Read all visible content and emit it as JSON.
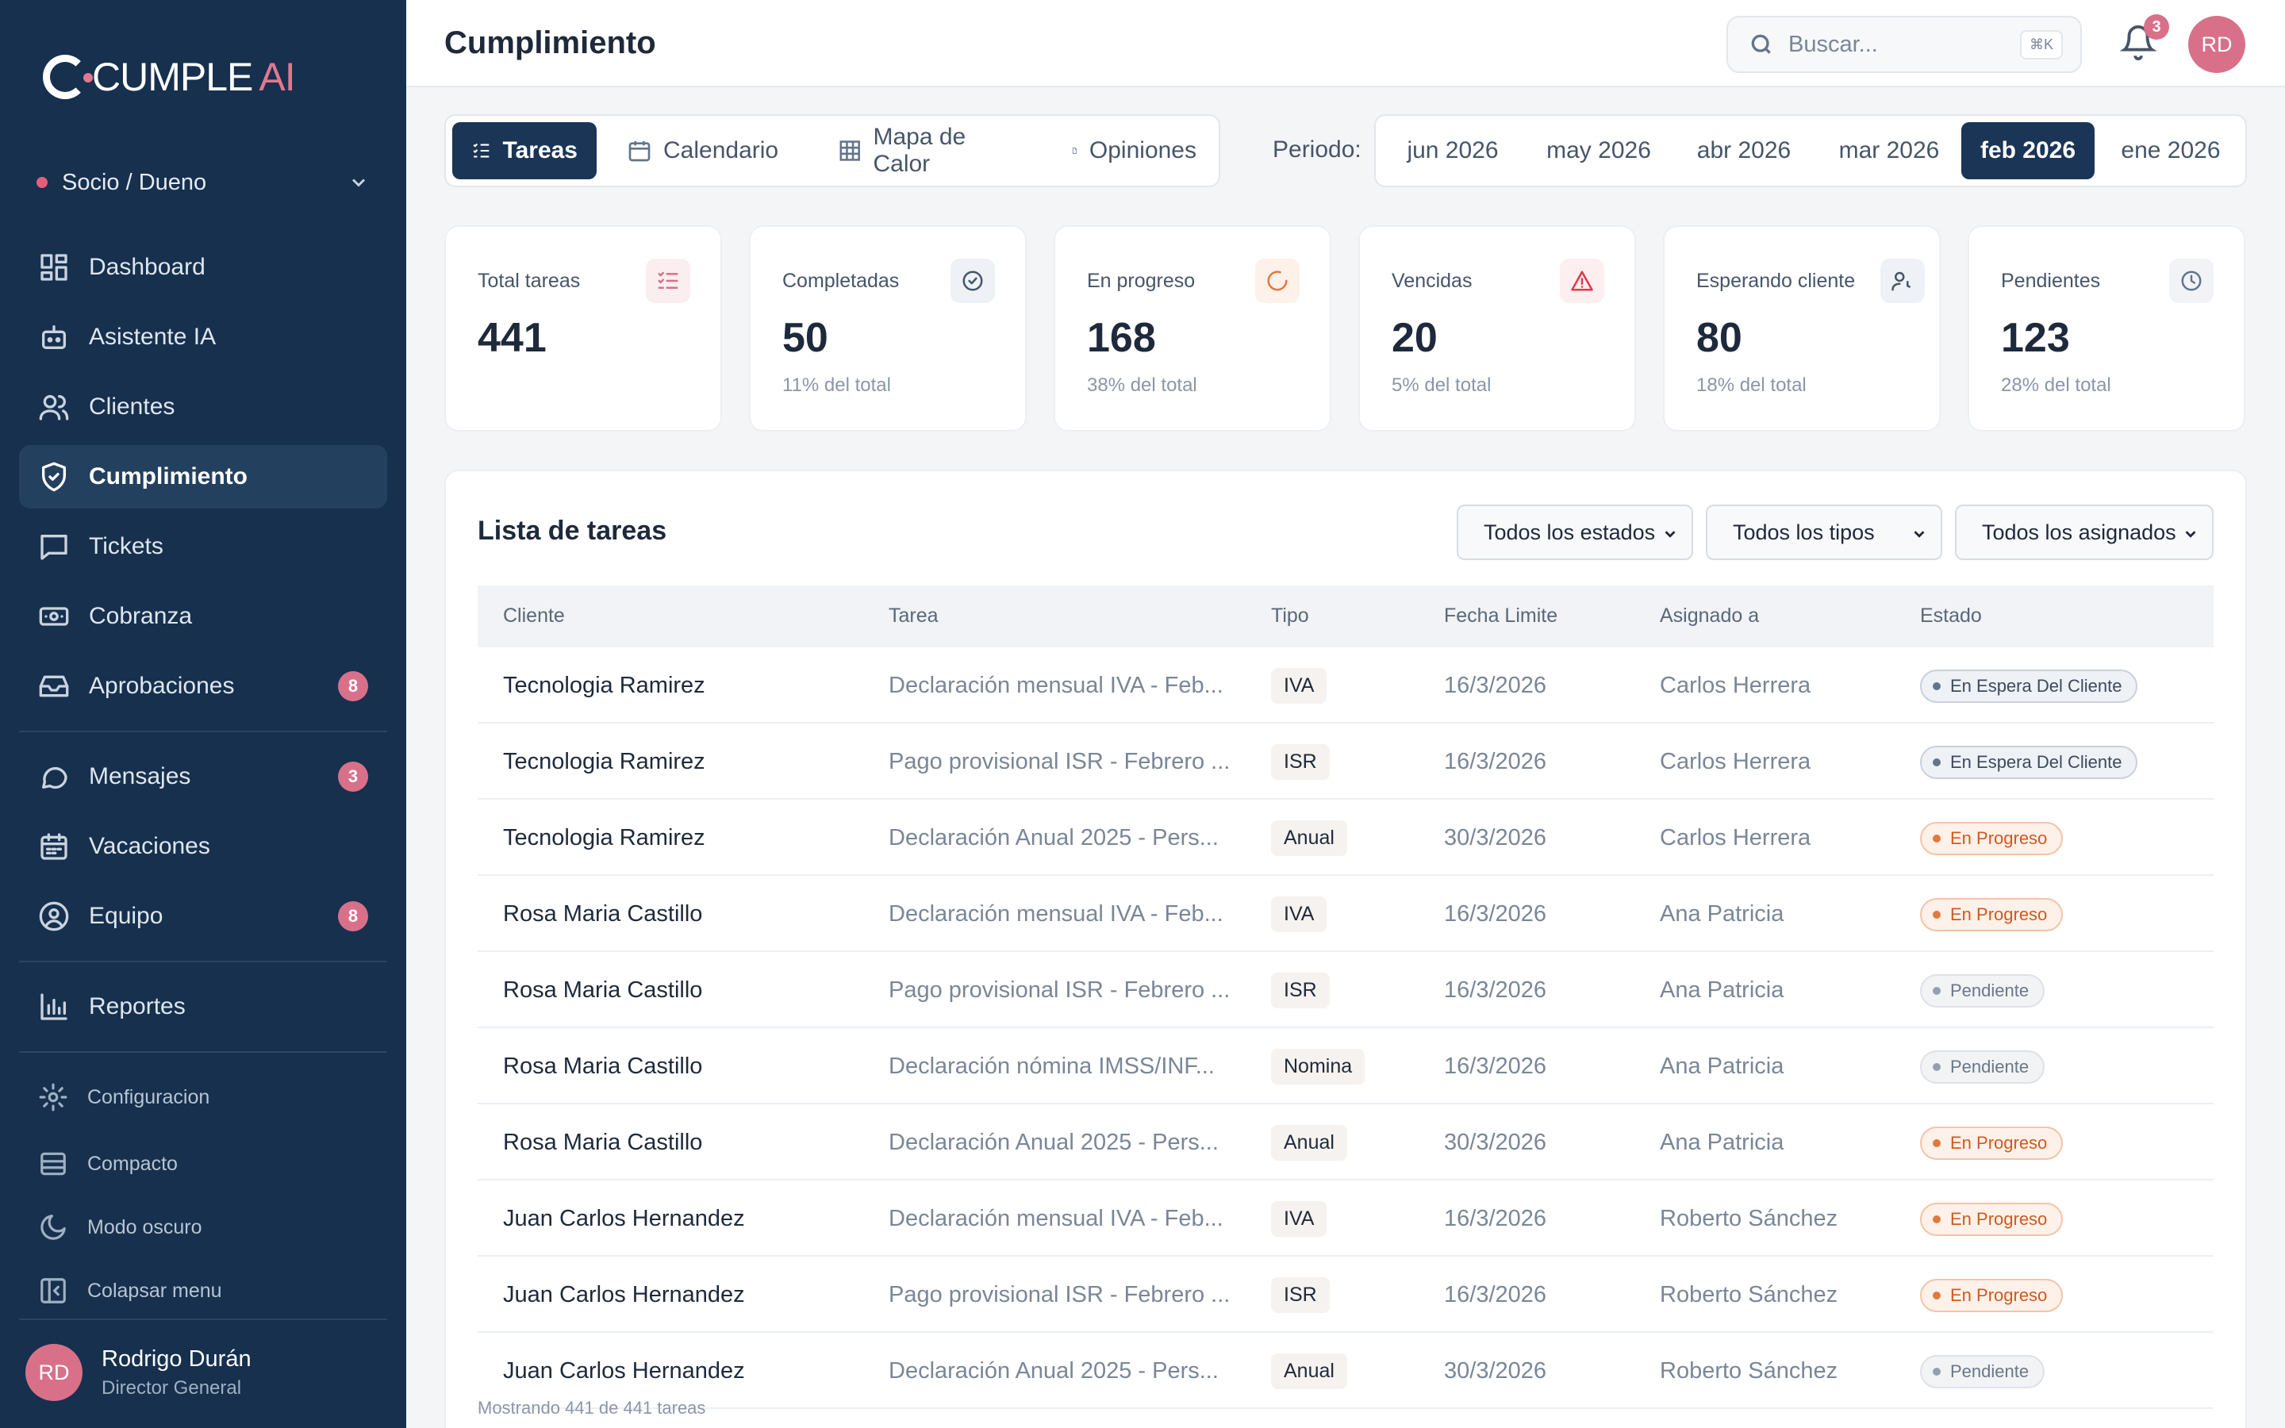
{
  "app": {
    "logo_main": "CUMPLE",
    "logo_ai": "AI",
    "role_selector": "Socio / Dueno"
  },
  "sidebar": {
    "items": [
      {
        "label": "Dashboard",
        "icon": "dashboard-icon"
      },
      {
        "label": "Asistente IA",
        "icon": "bot-icon"
      },
      {
        "label": "Clientes",
        "icon": "users-icon"
      },
      {
        "label": "Cumplimiento",
        "icon": "shield-check-icon",
        "active": true
      },
      {
        "label": "Tickets",
        "icon": "message-square-icon"
      },
      {
        "label": "Cobranza",
        "icon": "banknote-icon"
      },
      {
        "label": "Aprobaciones",
        "icon": "inbox-icon",
        "badge": "8"
      },
      {
        "label": "Mensajes",
        "icon": "chat-icon",
        "badge": "3"
      },
      {
        "label": "Vacaciones",
        "icon": "calendar-icon"
      },
      {
        "label": "Equipo",
        "icon": "user-circle-icon",
        "badge": "8"
      },
      {
        "label": "Reportes",
        "icon": "bar-chart-icon"
      }
    ],
    "bottom": [
      {
        "label": "Configuracion",
        "icon": "gear-icon"
      },
      {
        "label": "Compacto",
        "icon": "rows-icon"
      },
      {
        "label": "Modo oscuro",
        "icon": "moon-icon"
      },
      {
        "label": "Colapsar menu",
        "icon": "collapse-icon"
      }
    ],
    "profile": {
      "initials": "RD",
      "name": "Rodrigo Durán",
      "title": "Director General"
    }
  },
  "header": {
    "title": "Cumplimiento",
    "search_placeholder": "Buscar...",
    "shortcut": "⌘K",
    "notifications": "3",
    "avatar": "RD"
  },
  "tabs": [
    {
      "label": "Tareas",
      "icon": "list-check-icon",
      "active": true
    },
    {
      "label": "Calendario",
      "icon": "calendar-icon"
    },
    {
      "label": "Mapa de Calor",
      "icon": "grid-icon"
    },
    {
      "label": "Opiniones",
      "icon": "file-icon"
    }
  ],
  "period": {
    "label": "Periodo:",
    "options": [
      "jun 2026",
      "may 2026",
      "abr 2026",
      "mar 2026",
      "feb 2026",
      "ene 2026"
    ],
    "selected": "feb 2026"
  },
  "stats": [
    {
      "label": "Total tareas",
      "value": "441",
      "sub": "",
      "icon": "list-check-icon",
      "color": "#d9708a",
      "bg": "#fbeef1"
    },
    {
      "label": "Completadas",
      "value": "50",
      "sub": "11% del total",
      "icon": "check-circle-icon",
      "color": "#475569",
      "bg": "#eef1f5"
    },
    {
      "label": "En progreso",
      "value": "168",
      "sub": "38% del total",
      "icon": "loader-icon",
      "color": "#e07a3c",
      "bg": "#fdf1ea"
    },
    {
      "label": "Vencidas",
      "value": "20",
      "sub": "5% del total",
      "icon": "alert-triangle-icon",
      "color": "#dc3b4c",
      "bg": "#fdeef0"
    },
    {
      "label": "Esperando cliente",
      "value": "80",
      "sub": "18% del total",
      "icon": "user-clock-icon",
      "color": "#475569",
      "bg": "#eef1f5"
    },
    {
      "label": "Pendientes",
      "value": "123",
      "sub": "28% del total",
      "icon": "clock-icon",
      "color": "#64748b",
      "bg": "#f1f3f6"
    }
  ],
  "task_list": {
    "title": "Lista de tareas",
    "filters": [
      "Todos los estados",
      "Todos los tipos",
      "Todos los asignados"
    ],
    "columns": [
      "Cliente",
      "Tarea",
      "Tipo",
      "Fecha Limite",
      "Asignado a",
      "Estado"
    ],
    "rows": [
      {
        "client": "Tecnologia Ramirez",
        "task": "Declaración mensual IVA - Feb...",
        "type": "IVA",
        "date": "16/3/2026",
        "assigned": "Carlos Herrera",
        "status": "En Espera Del Cliente",
        "kind": "wait"
      },
      {
        "client": "Tecnologia Ramirez",
        "task": "Pago provisional ISR - Febrero ...",
        "type": "ISR",
        "date": "16/3/2026",
        "assigned": "Carlos Herrera",
        "status": "En Espera Del Cliente",
        "kind": "wait"
      },
      {
        "client": "Tecnologia Ramirez",
        "task": "Declaración Anual 2025 - Pers...",
        "type": "Anual",
        "date": "30/3/2026",
        "assigned": "Carlos Herrera",
        "status": "En Progreso",
        "kind": "prog"
      },
      {
        "client": "Rosa Maria Castillo",
        "task": "Declaración mensual IVA - Feb...",
        "type": "IVA",
        "date": "16/3/2026",
        "assigned": "Ana Patricia",
        "status": "En Progreso",
        "kind": "prog"
      },
      {
        "client": "Rosa Maria Castillo",
        "task": "Pago provisional ISR - Febrero ...",
        "type": "ISR",
        "date": "16/3/2026",
        "assigned": "Ana Patricia",
        "status": "Pendiente",
        "kind": "pend"
      },
      {
        "client": "Rosa Maria Castillo",
        "task": "Declaración nómina IMSS/INF...",
        "type": "Nomina",
        "date": "16/3/2026",
        "assigned": "Ana Patricia",
        "status": "Pendiente",
        "kind": "pend"
      },
      {
        "client": "Rosa Maria Castillo",
        "task": "Declaración Anual 2025 - Pers...",
        "type": "Anual",
        "date": "30/3/2026",
        "assigned": "Ana Patricia",
        "status": "En Progreso",
        "kind": "prog"
      },
      {
        "client": "Juan Carlos Hernandez",
        "task": "Declaración mensual IVA - Feb...",
        "type": "IVA",
        "date": "16/3/2026",
        "assigned": "Roberto Sánchez",
        "status": "En Progreso",
        "kind": "prog"
      },
      {
        "client": "Juan Carlos Hernandez",
        "task": "Pago provisional ISR - Febrero ...",
        "type": "ISR",
        "date": "16/3/2026",
        "assigned": "Roberto Sánchez",
        "status": "En Progreso",
        "kind": "prog"
      },
      {
        "client": "Juan Carlos Hernandez",
        "task": "Declaración Anual 2025 - Pers...",
        "type": "Anual",
        "date": "30/3/2026",
        "assigned": "Roberto Sánchez",
        "status": "Pendiente",
        "kind": "pend"
      }
    ],
    "footer": "Mostrando 441 de 441 tareas"
  }
}
